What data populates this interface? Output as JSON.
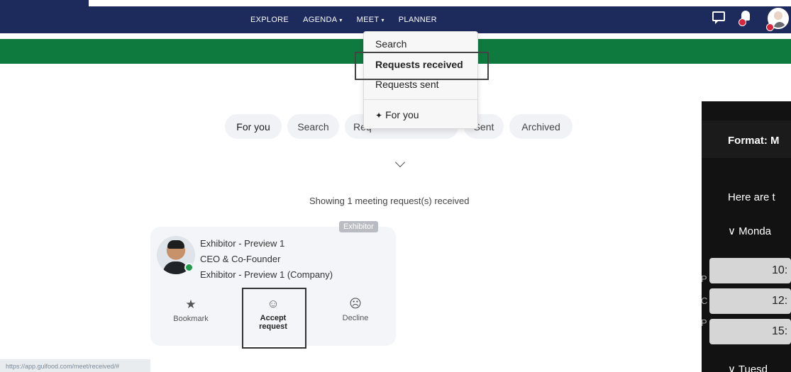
{
  "nav": {
    "links": [
      {
        "label": "EXPLORE",
        "caret": ""
      },
      {
        "label": "AGENDA",
        "caret": "▾"
      },
      {
        "label": "MEET",
        "caret": "▾"
      },
      {
        "label": "PLANNER",
        "caret": ""
      }
    ]
  },
  "dropdown": {
    "items": [
      "Search",
      "Requests received",
      "Requests sent"
    ],
    "for_you": "For you"
  },
  "tabs": [
    "For you",
    "Search",
    "Req",
    "Sent",
    "Archived"
  ],
  "result_text": "Showing 1 meeting request(s) received",
  "card": {
    "badge": "Exhibitor",
    "name": "Exhibitor - Preview 1",
    "title": "CEO & Co-Founder",
    "company": "Exhibitor - Preview 1 (Company)",
    "actions": {
      "bookmark": "Bookmark",
      "accept_line1": "Accept",
      "accept_line2": "request",
      "decline": "Decline"
    }
  },
  "status_url": "https://app.gulfood.com/meet/received/#",
  "panel": {
    "format": "Format: M",
    "intro": "Here are t",
    "day1": "∨ Monda",
    "slots": [
      "10:",
      "12:",
      "15:"
    ],
    "letters": [
      "P",
      "C",
      "P"
    ],
    "day2": "∨ Tuesd"
  },
  "colors": {
    "nav_bg": "#1d2a5c",
    "green_bar": "#0e7a3e",
    "online": "#1f9a4a",
    "alert": "#d7263d"
  }
}
